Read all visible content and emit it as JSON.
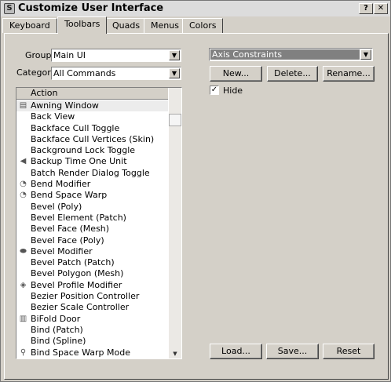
{
  "window": {
    "title": "Customize User Interface",
    "help_button": "?",
    "close_button": "✕"
  },
  "tabs": [
    {
      "label": "Keyboard",
      "active": false
    },
    {
      "label": "Toolbars",
      "active": true
    },
    {
      "label": "Quads",
      "active": false
    },
    {
      "label": "Menus",
      "active": false
    },
    {
      "label": "Colors",
      "active": false
    }
  ],
  "left": {
    "group_label": "Group:",
    "group_value": "Main UI",
    "category_label": "Category:",
    "category_value": "All Commands",
    "list_header": "Action",
    "actions": [
      {
        "label": "Awning Window",
        "icon": "awning-window-icon",
        "glyph": "▤"
      },
      {
        "label": "Back View",
        "icon": "",
        "glyph": ""
      },
      {
        "label": "Backface Cull Toggle",
        "icon": "",
        "glyph": ""
      },
      {
        "label": "Backface Cull Vertices (Skin)",
        "icon": "",
        "glyph": ""
      },
      {
        "label": "Background Lock Toggle",
        "icon": "",
        "glyph": ""
      },
      {
        "label": "Backup Time One Unit",
        "icon": "backup-time-icon",
        "glyph": "◀"
      },
      {
        "label": "Batch Render Dialog Toggle",
        "icon": "",
        "glyph": ""
      },
      {
        "label": "Bend Modifier",
        "icon": "bend-modifier-icon",
        "glyph": "◔"
      },
      {
        "label": "Bend Space Warp",
        "icon": "bend-space-warp-icon",
        "glyph": "◔"
      },
      {
        "label": "Bevel (Poly)",
        "icon": "",
        "glyph": ""
      },
      {
        "label": "Bevel Element (Patch)",
        "icon": "",
        "glyph": ""
      },
      {
        "label": "Bevel Face (Mesh)",
        "icon": "",
        "glyph": ""
      },
      {
        "label": "Bevel Face (Poly)",
        "icon": "",
        "glyph": ""
      },
      {
        "label": "Bevel Modifier",
        "icon": "bevel-modifier-icon",
        "glyph": "⬬"
      },
      {
        "label": "Bevel Patch (Patch)",
        "icon": "",
        "glyph": ""
      },
      {
        "label": "Bevel Polygon (Mesh)",
        "icon": "",
        "glyph": ""
      },
      {
        "label": "Bevel Profile Modifier",
        "icon": "bevel-profile-modifier-icon",
        "glyph": "◈"
      },
      {
        "label": "Bezier Position Controller",
        "icon": "",
        "glyph": ""
      },
      {
        "label": "Bezier Scale Controller",
        "icon": "",
        "glyph": ""
      },
      {
        "label": "BiFold Door",
        "icon": "bifold-door-icon",
        "glyph": "▥"
      },
      {
        "label": "Bind (Patch)",
        "icon": "",
        "glyph": ""
      },
      {
        "label": "Bind (Spline)",
        "icon": "",
        "glyph": ""
      },
      {
        "label": "Bind Space Warp Mode",
        "icon": "bind-space-warp-icon",
        "glyph": "⚲"
      }
    ]
  },
  "right": {
    "toolbar_value": "Axis Constraints",
    "new_button": "New...",
    "delete_button": "Delete...",
    "rename_button": "Rename...",
    "hide_label": "Hide",
    "hide_checked": true,
    "check_mark": "✓",
    "load_button": "Load...",
    "save_button": "Save...",
    "reset_button": "Reset"
  }
}
